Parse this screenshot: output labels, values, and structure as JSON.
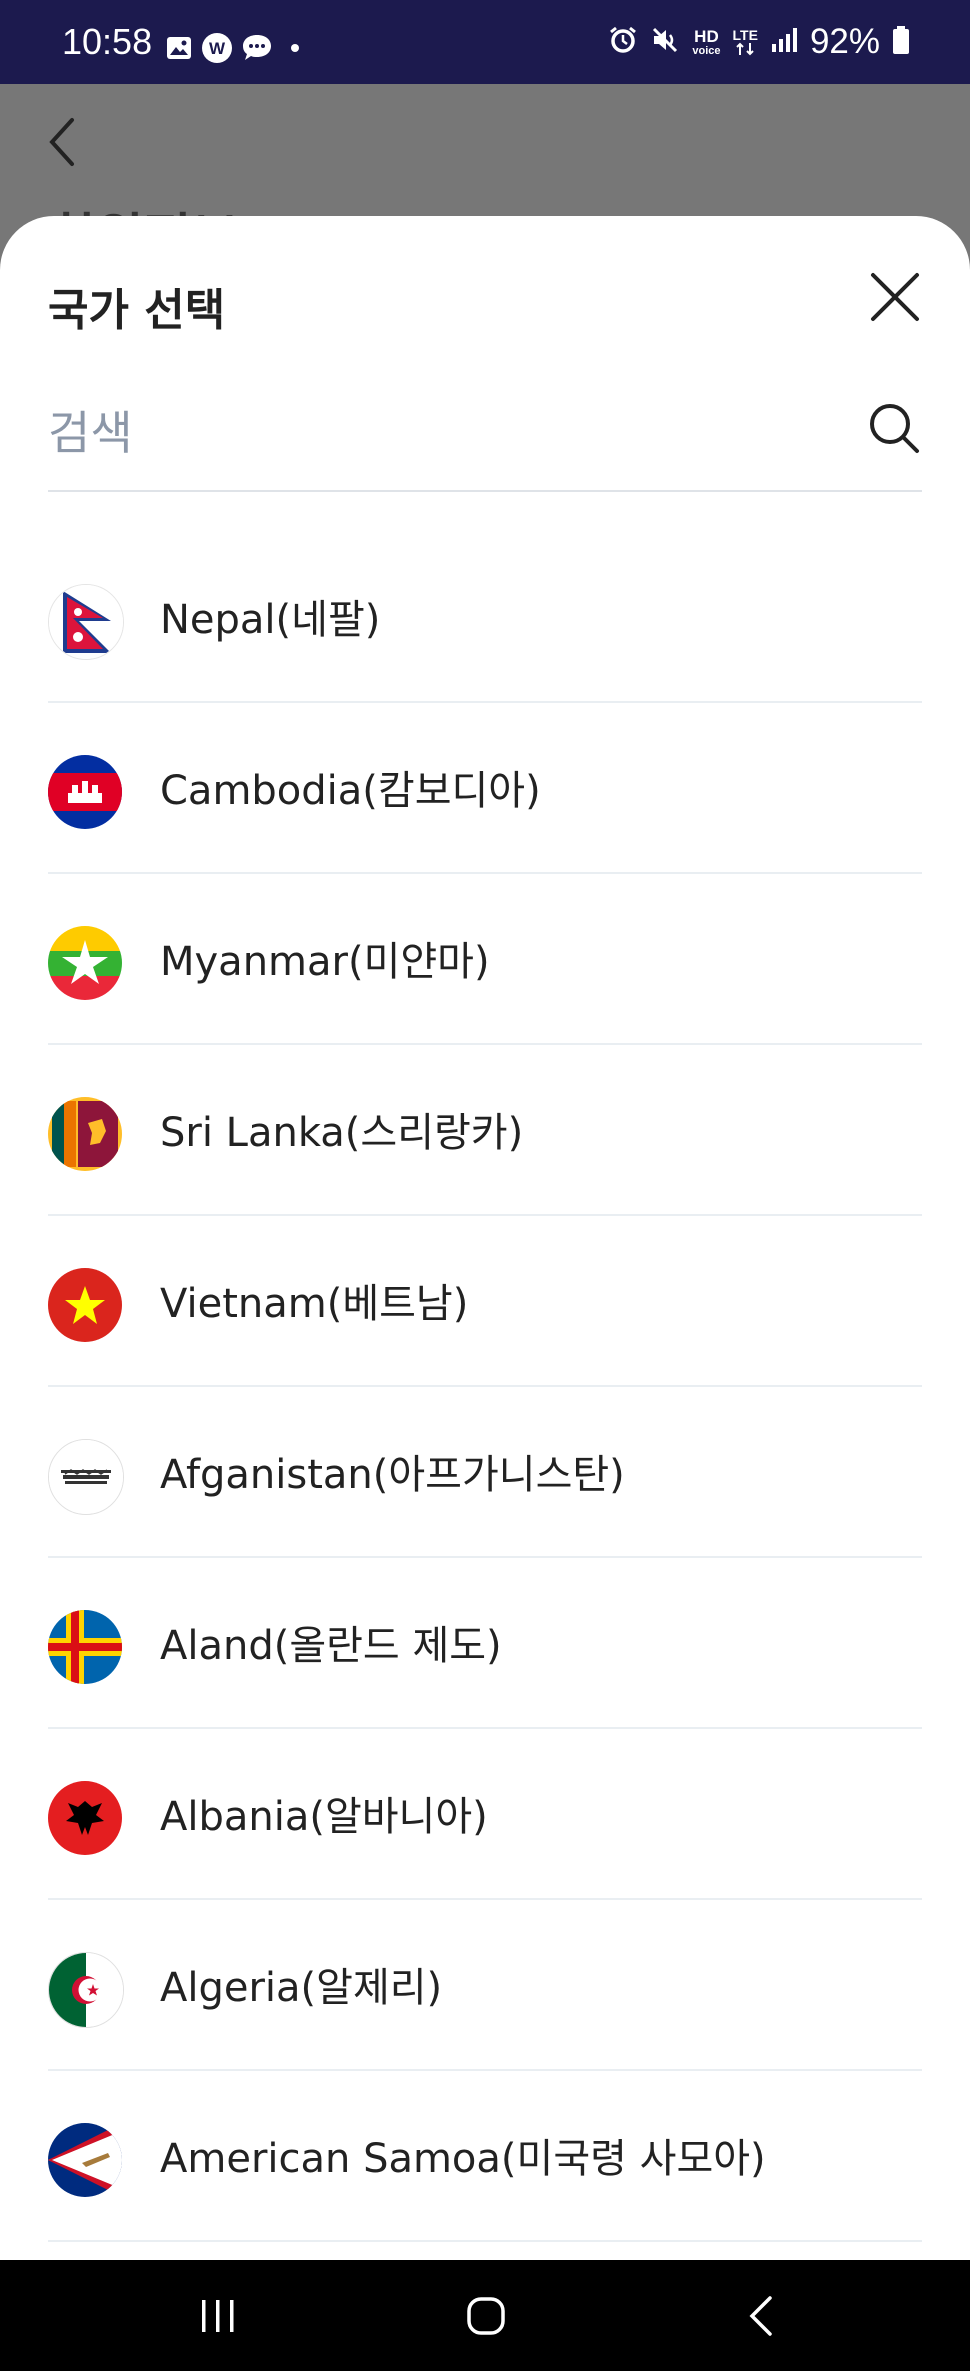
{
  "status_bar": {
    "time": "10:58",
    "battery": "92%",
    "hd_label": "HD",
    "voice_label": "voice",
    "lte_label": "LTE"
  },
  "background_page": {
    "back_icon": "chevron-left-icon",
    "title": "회원정보"
  },
  "sheet": {
    "title": "국가 선택",
    "close_icon": "close-icon",
    "search": {
      "placeholder": "검색",
      "value": "",
      "icon": "search-icon"
    },
    "countries": [
      {
        "label": "Nepal(네팔)",
        "flag": "nepal-flag-icon"
      },
      {
        "label": "Cambodia(캄보디아)",
        "flag": "cambodia-flag-icon"
      },
      {
        "label": "Myanmar(미얀마)",
        "flag": "myanmar-flag-icon"
      },
      {
        "label": "Sri Lanka(스리랑카)",
        "flag": "sri-lanka-flag-icon"
      },
      {
        "label": "Vietnam(베트남)",
        "flag": "vietnam-flag-icon"
      },
      {
        "label": "Afganistan(아프가니스탄)",
        "flag": "afghanistan-flag-icon"
      },
      {
        "label": "Aland(올란드 제도)",
        "flag": "aland-flag-icon"
      },
      {
        "label": "Albania(알바니아)",
        "flag": "albania-flag-icon"
      },
      {
        "label": "Algeria(알제리)",
        "flag": "algeria-flag-icon"
      },
      {
        "label": "American Samoa(미국령 사모아)",
        "flag": "american-samoa-flag-icon"
      }
    ]
  },
  "nav_bar": {
    "recents_icon": "recents-icon",
    "home_icon": "home-icon",
    "back_icon": "back-icon"
  },
  "colors": {
    "status_bar_bg": "#1c1a4e",
    "scrim": "#777777",
    "divider": "#e9eef2",
    "placeholder": "#8c97a8",
    "text": "#222222"
  }
}
